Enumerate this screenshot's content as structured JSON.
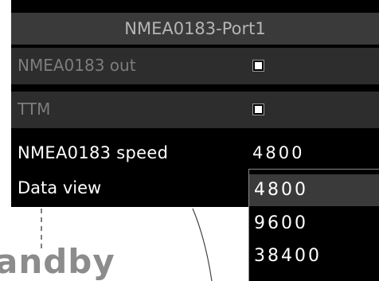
{
  "background": {
    "text": "andby"
  },
  "menu": {
    "title": "NMEA0183-Port1",
    "rows": [
      {
        "label": "NMEA0183  out",
        "checked": true
      },
      {
        "label": "TTM",
        "checked": true
      }
    ],
    "speed": {
      "label": "NMEA0183  speed",
      "value": "4800"
    },
    "data_view": {
      "label": "Data  view"
    }
  },
  "dropdown": {
    "options": [
      "4800",
      "9600",
      "38400"
    ],
    "selected": "4800"
  }
}
